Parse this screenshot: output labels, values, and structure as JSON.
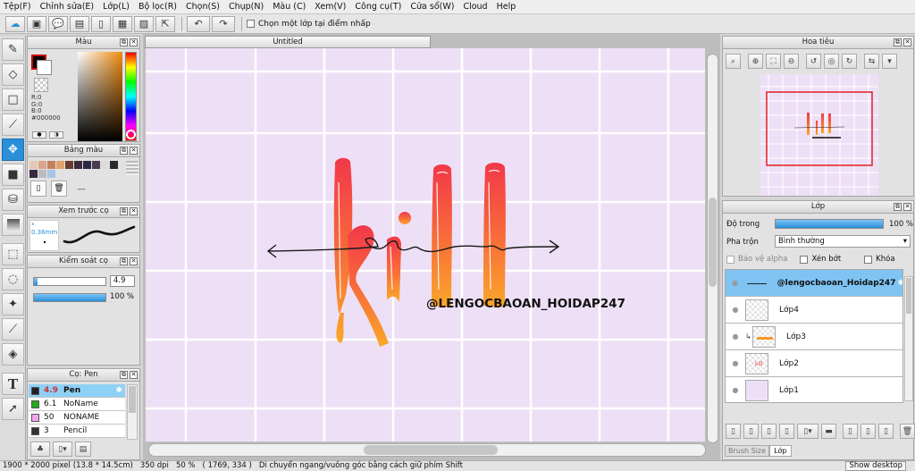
{
  "menu": [
    "Tệp(F)",
    "Chỉnh sửa(E)",
    "Lớp(L)",
    "Bộ lọc(R)",
    "Chọn(S)",
    "Chụp(N)",
    "Màu (C)",
    "Xem(V)",
    "Công cụ(T)",
    "Cửa sổ(W)",
    "Cloud",
    "Help"
  ],
  "toolbar": {
    "select_layer_label": "Chọn một lớp tại điểm nhấp"
  },
  "color_panel": {
    "title": "Màu",
    "r": "R:0",
    "g": "G:0",
    "b": "B:0",
    "hex": "#000000",
    "main_color": "#000000"
  },
  "palette_panel": {
    "title": "Bảng màu",
    "dashes": "---"
  },
  "brush_preview_panel": {
    "title": "Xem trước cọ",
    "size": "* 0.36mm"
  },
  "brush_control_panel": {
    "title": "Kiểm soát cọ",
    "size_value": "4.9",
    "opacity_value": "100 %",
    "opacity_fraction": 1.0,
    "size_fraction": 0.05
  },
  "brush_panel": {
    "title": "Cọ: Pen",
    "items": [
      {
        "size": "4.9",
        "name": "Pen",
        "color": "#222222",
        "selected": true
      },
      {
        "size": "6.1",
        "name": "NoName",
        "color": "#22aa22",
        "selected": false
      },
      {
        "size": "50",
        "name": "NONAME",
        "color": "#f4a6f0",
        "selected": false
      },
      {
        "size": "3",
        "name": "Pencil",
        "color": "#333333",
        "selected": false
      }
    ]
  },
  "document": {
    "tab_title": "Untitled"
  },
  "artwork": {
    "word": "kill",
    "handle": "@LENGOCBAOAN_HOIDAP247"
  },
  "navigator_panel": {
    "title": "Hoa tiêu"
  },
  "layer_panel": {
    "title": "Lớp",
    "opacity_label": "Độ trong",
    "opacity_value": "100 %",
    "opacity_fraction": 1.0,
    "blend_label": "Pha trộn",
    "blend_value": "Bình thường",
    "protect_alpha": "Bảo vệ alpha",
    "clipping": "Xén bớt",
    "lock": "Khóa",
    "layers": [
      {
        "name": "@lengocbaoan_Hoidap247",
        "selected": true
      },
      {
        "name": "Lớp4",
        "selected": false
      },
      {
        "name": "Lớp3",
        "selected": false
      },
      {
        "name": "Lớp2",
        "selected": false
      },
      {
        "name": "Lớp1",
        "selected": false
      }
    ],
    "tab_brush_size": "Brush Size",
    "tab_layer": "Lớp"
  },
  "status": {
    "size": "1900 * 2000 pixel",
    "cm": "(13.8 * 14.5cm)",
    "dpi": "350 dpi",
    "zoom": "50 %",
    "coords": "( 1769, 334 )",
    "hint": "Di chuyển ngang/vuông góc bằng cách giữ phím Shift",
    "show_desktop": "Show desktop"
  },
  "colors": {
    "accent": "#2a8fd8",
    "canvas_bg": "#ede0f6",
    "grid": "#ffffff",
    "letter_top": "#f2384a",
    "letter_bottom": "#fba72a"
  }
}
